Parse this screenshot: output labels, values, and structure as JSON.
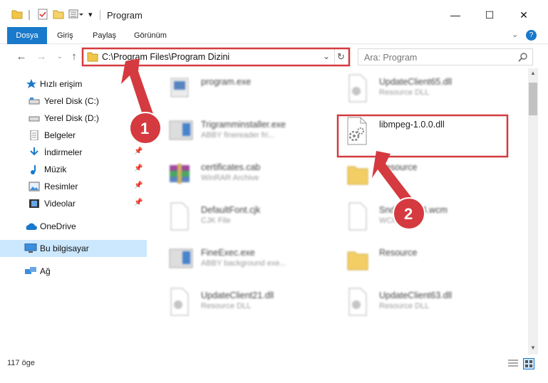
{
  "window": {
    "title": "Program",
    "controls": {
      "minimize": "—",
      "maximize": "☐",
      "close": "✕"
    }
  },
  "ribbon": {
    "tabs": [
      "Dosya",
      "Giriş",
      "Paylaş",
      "Görünüm"
    ]
  },
  "address": {
    "path": "C:\\Program Files\\Program Dizini",
    "search_placeholder": "Ara: Program"
  },
  "sidebar": {
    "items": [
      {
        "label": "Hızlı erişim",
        "icon": "star-icon"
      },
      {
        "label": "Yerel Disk (C:)",
        "icon": "drive-icon"
      },
      {
        "label": "Yerel Disk (D:)",
        "icon": "drive-icon"
      },
      {
        "label": "Belgeler",
        "icon": "documents-icon"
      },
      {
        "label": "İndirmeler",
        "icon": "download-icon"
      },
      {
        "label": "Müzik",
        "icon": "music-icon"
      },
      {
        "label": "Resimler",
        "icon": "pictures-icon"
      },
      {
        "label": "Videolar",
        "icon": "videos-icon"
      },
      {
        "label": "OneDrive",
        "icon": "cloud-icon"
      },
      {
        "label": "Bu bilgisayar",
        "icon": "computer-icon"
      },
      {
        "label": "Ağ",
        "icon": "network-icon"
      }
    ]
  },
  "files": {
    "col1": [
      {
        "name": "program.exe",
        "type": ""
      },
      {
        "name": "Trigramminstaller.exe",
        "type": "ABBY finereader fri..."
      },
      {
        "name": "certificates.cab",
        "type": "WinRAR Archive"
      },
      {
        "name": "DefaultFont.cjk",
        "type": "CJK File"
      },
      {
        "name": "FineExec.exe",
        "type": "ABBY background exe..."
      },
      {
        "name": "UpdateClient21.dll",
        "type": "Resource DLL"
      }
    ],
    "col2": [
      {
        "name": "UpdateClient65.dll",
        "type": "Resource DLL"
      },
      {
        "name": "libmpeg-1.0.0.dll",
        "type": ""
      },
      {
        "name": "Resource",
        "type": ""
      },
      {
        "name": "SndRecX64.wcm",
        "type": "WCM File"
      },
      {
        "name": "Resource",
        "type": ""
      },
      {
        "name": "UpdateClient63.dll",
        "type": "Resource DLL"
      }
    ]
  },
  "status": {
    "item_count": "117 öge"
  },
  "annotations": {
    "callout1": "1",
    "callout2": "2"
  },
  "colors": {
    "accent": "#1979ca",
    "highlight": "#d43a3f",
    "selected": "#cce8ff"
  }
}
